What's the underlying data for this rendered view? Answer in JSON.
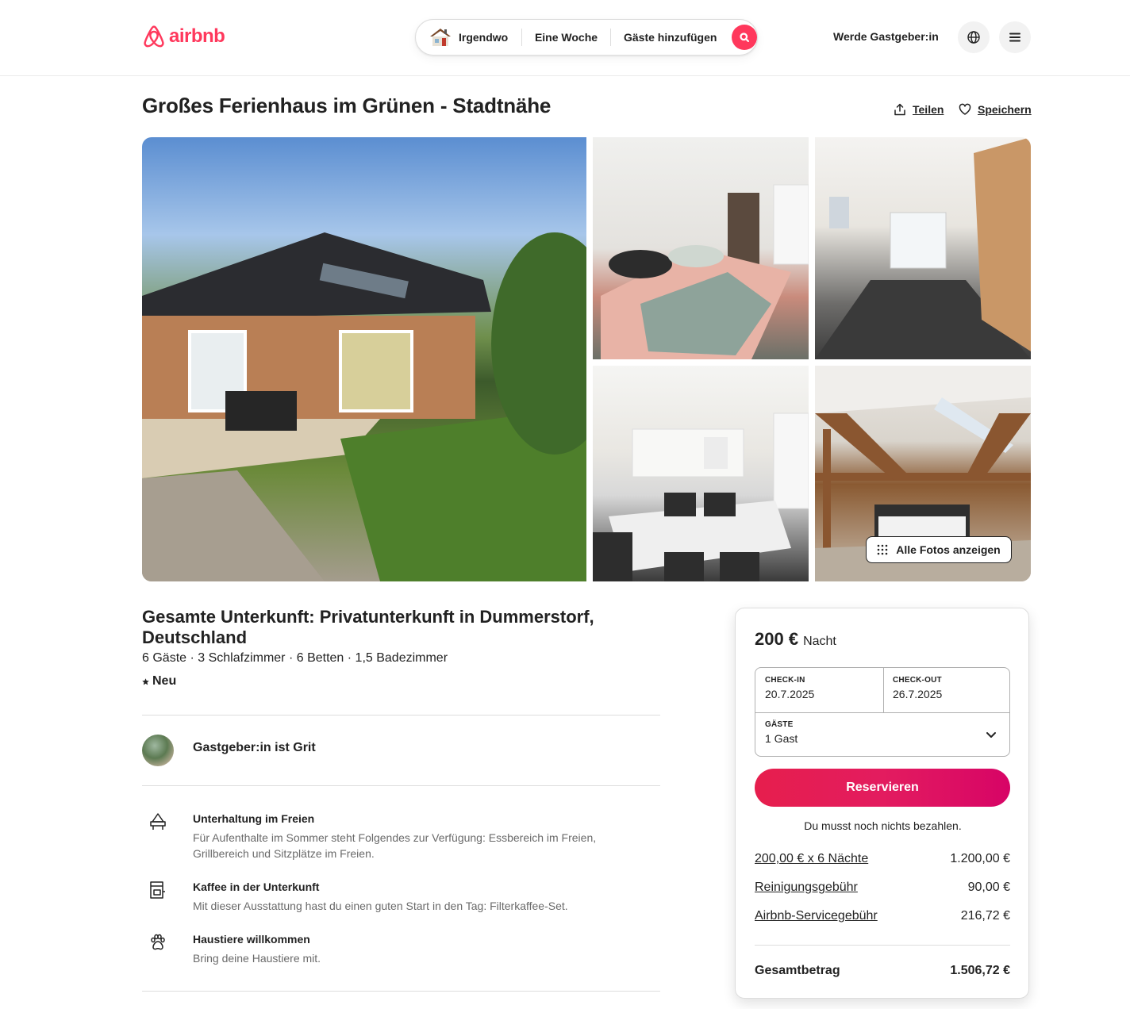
{
  "header": {
    "logo_text": "airbnb",
    "search": {
      "where": "Irgendwo",
      "when": "Eine Woche",
      "guests": "Gäste hinzufügen"
    },
    "host_link": "Werde Gastgeber:in"
  },
  "listing": {
    "title": "Großes Ferienhaus im Grünen - Stadtnähe",
    "share_label": "Teilen",
    "save_label": "Speichern",
    "show_all_photos": "Alle Fotos anzeigen",
    "subtitle": "Gesamte Unterkunft: Privatunterkunft in Dummerstorf, Deutschland",
    "facts": "6 Gäste · 3 Schlafzimmer · 6 Betten · 1,5 Badezimmer",
    "rating_badge": "Neu",
    "host": "Gastgeber:in ist Grit",
    "features": [
      {
        "icon": "outdoor-dining-icon",
        "title": "Unterhaltung im Freien",
        "desc": "Für Aufenthalte im Sommer steht Folgendes zur Verfügung: Essbereich im Freien, Grillbereich und Sitzplätze im Freien."
      },
      {
        "icon": "coffee-maker-icon",
        "title": "Kaffee in der Unterkunft",
        "desc": "Mit dieser Ausstattung hast du einen guten Start in den Tag: Filterkaffee-Set."
      },
      {
        "icon": "paw-icon",
        "title": "Haustiere willkommen",
        "desc": "Bring deine Haustiere mit."
      }
    ]
  },
  "booking": {
    "price": "200 €",
    "price_unit": "Nacht",
    "checkin_label": "CHECK-IN",
    "checkin_value": "20.7.2025",
    "checkout_label": "CHECK-OUT",
    "checkout_value": "26.7.2025",
    "guests_label": "GÄSTE",
    "guests_value": "1 Gast",
    "reserve_label": "Reservieren",
    "no_charge_note": "Du musst noch nichts bezahlen.",
    "fees": [
      {
        "label": "200,00 € x 6 Nächte",
        "amount": "1.200,00 €"
      },
      {
        "label": "Reinigungsgebühr",
        "amount": "90,00 €"
      },
      {
        "label": "Airbnb-Servicegebühr",
        "amount": "216,72 €"
      }
    ],
    "total_label": "Gesamtbetrag",
    "total_amount": "1.506,72 €"
  },
  "colors": {
    "brand": "#ff385c",
    "reserve_gradient_start": "#e61e4d",
    "reserve_gradient_end": "#d70466"
  }
}
